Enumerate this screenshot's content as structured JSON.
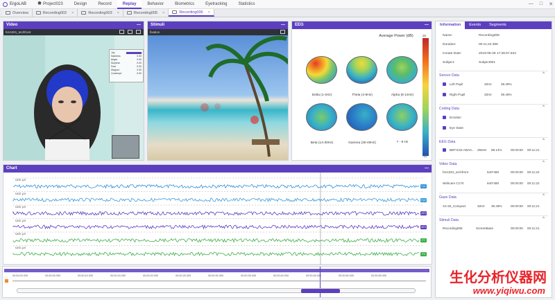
{
  "app": {
    "name": "ErgoLAB",
    "project": "Project023",
    "nav": [
      "Design",
      "Record",
      "Replay",
      "Behavior",
      "Biometrics",
      "Eyetracking",
      "Statistics"
    ],
    "active_nav": "Replay",
    "window_controls": [
      "—",
      "□",
      "✕"
    ]
  },
  "tabs": [
    {
      "label": "Overview",
      "active": false
    },
    {
      "label": "Recording002",
      "active": false
    },
    {
      "label": "Recording003",
      "active": false
    },
    {
      "label": "Recording005",
      "active": false
    },
    {
      "label": "Recording006",
      "active": true
    }
  ],
  "video": {
    "title": "Video",
    "source": "hm1001_techfront",
    "fps": "01:00:20:10"
  },
  "stimuli": {
    "title": "Stimuli",
    "source": "fixation"
  },
  "eeg": {
    "title": "EEG",
    "chart_title": "Average Power (dB)",
    "scale_max": "25",
    "scale_min": "-10",
    "bands": [
      {
        "label": "Delta (1-4Hz)"
      },
      {
        "label": "Theta (4-8Hz)"
      },
      {
        "label": "Alpha (8-14Hz)"
      },
      {
        "label": "Beta (14-30Hz)"
      },
      {
        "label": "Gamma (30-49Hz)"
      },
      {
        "label": "7  - 8  Hz"
      }
    ]
  },
  "info": {
    "tabs": [
      "Information",
      "Events",
      "Segments"
    ],
    "fields": [
      {
        "label": "Name:",
        "value": "Recording006"
      },
      {
        "label": "Duration:",
        "value": "00:11:22.399"
      },
      {
        "label": "Create Date:",
        "value": "2019-08-28 17:36:57.634"
      },
      {
        "label": "Subject:",
        "value": "Subject001"
      }
    ],
    "sections": {
      "sensor": {
        "title": "Sensor Data",
        "rows": [
          {
            "name": "Left Pupil",
            "rate": "32Hz",
            "pct": "39.49%"
          },
          {
            "name": "Right Pupil",
            "rate": "32Hz",
            "pct": "39.49%"
          }
        ]
      },
      "coding": {
        "title": "Coding Data",
        "rows": [
          {
            "name": "Emotion"
          },
          {
            "name": "Eye State"
          }
        ]
      },
      "eeg": {
        "title": "EEG Data",
        "rows": [
          {
            "name": "BBT-E32-ABA0...",
            "rate": "256Hz",
            "pct": "99.14%",
            "start": "00:00:00",
            "end": "00:11:21"
          }
        ]
      },
      "video": {
        "title": "Video Data",
        "rows": [
          {
            "name": "hm1001_techfront",
            "res": "640*480",
            "start": "00:00:00",
            "end": "00:11:22"
          },
          {
            "name": "Webcam C170",
            "res": "640*480",
            "start": "00:00:00",
            "end": "00:11:22"
          }
        ]
      },
      "gaze": {
        "title": "Gaze Data",
        "rows": [
          {
            "name": "X2-30_Compact",
            "rate": "32Hz",
            "pct": "39.49%",
            "start": "00:00:00",
            "end": "00:11:21"
          }
        ]
      },
      "stimuli": {
        "title": "Stimuli Data",
        "rows": [
          {
            "name": "Recording006",
            "type": "ScreenBase",
            "start": "00:00:00",
            "end": "00:11:21"
          }
        ]
      }
    }
  },
  "chart": {
    "title": "Chart",
    "unit": "Unit: μV",
    "channels": [
      {
        "tag": "Fp1",
        "color": "#2f8fd8"
      },
      {
        "tag": "Fp2",
        "color": "#3c9ad8"
      },
      {
        "tag": "AF3",
        "color": "#5c3fbf"
      },
      {
        "tag": "AF4",
        "color": "#5c3fbf"
      },
      {
        "tag": "F7",
        "color": "#3fae4a"
      },
      {
        "tag": "F3",
        "color": "#3fae4a"
      }
    ]
  },
  "timeline": {
    "ticks": [
      "00:00:00.000",
      "00:00:05.000",
      "00:00:10.000",
      "00:00:15.000",
      "00:00:20.000",
      "00:00:25.000",
      "00:00:30.000",
      "00:00:35.000",
      "00:00:40.000",
      "00:00:45.000",
      "00:00:50.000",
      "00:00:55.000"
    ]
  },
  "watermark": {
    "cn": "生化分析仪器网",
    "url": "www.yiqiwu.com"
  }
}
